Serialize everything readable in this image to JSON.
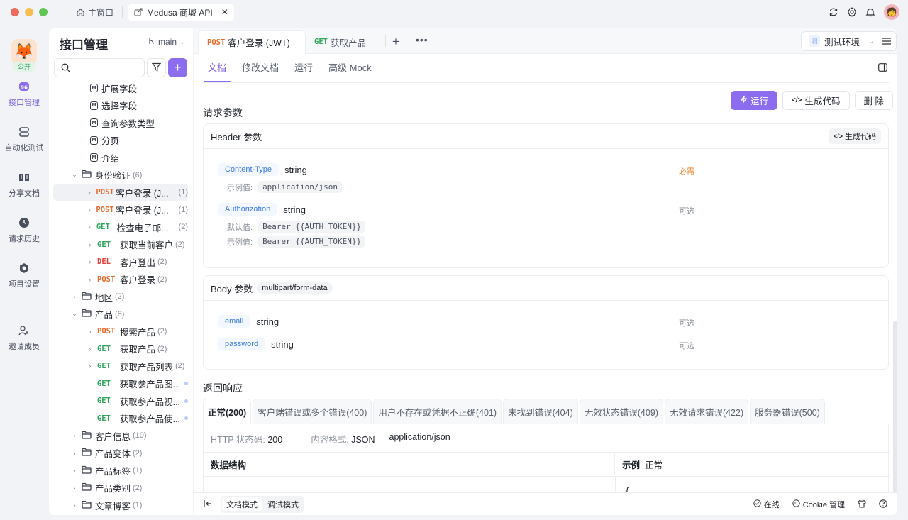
{
  "titlebar": {
    "home_label": "主窗口",
    "window_tab": "Medusa 商城 API"
  },
  "rail": {
    "public_badge": "公开",
    "items": [
      {
        "label": "接口管理",
        "icon": "api-icon",
        "active": true
      },
      {
        "label": "自动化测试",
        "icon": "automation-icon"
      },
      {
        "label": "分享文档",
        "icon": "book-icon"
      },
      {
        "label": "请求历史",
        "icon": "clock-icon"
      },
      {
        "label": "项目设置",
        "icon": "settings-hex-icon"
      },
      {
        "label": "邀请成员",
        "icon": "user-plus-icon"
      }
    ]
  },
  "sidebar": {
    "title": "接口管理",
    "branch": "main",
    "search_placeholder": "",
    "tree": [
      {
        "type": "doc",
        "label": "扩展字段",
        "indent": 2
      },
      {
        "type": "doc",
        "label": "选择字段",
        "indent": 2
      },
      {
        "type": "doc",
        "label": "查询参数类型",
        "indent": 2
      },
      {
        "type": "doc",
        "label": "分页",
        "indent": 2
      },
      {
        "type": "doc",
        "label": "介绍",
        "indent": 2
      },
      {
        "type": "folder",
        "label": "身份验证",
        "count": "(6)",
        "expanded": true,
        "indent": 1
      },
      {
        "type": "api",
        "method": "POST",
        "label": "客户登录 (J...",
        "count": "(1)",
        "indent": 2,
        "selected": true,
        "chev": true
      },
      {
        "type": "api",
        "method": "POST",
        "label": "客户登录 (J...",
        "count": "(1)",
        "indent": 2,
        "chev": true
      },
      {
        "type": "api",
        "method": "GET",
        "label": "检查电子邮...",
        "count": "(2)",
        "indent": 2,
        "chev": true
      },
      {
        "type": "api",
        "method": "GET",
        "label": "获取当前客户",
        "count": "(2)",
        "indent": 2,
        "chev": true
      },
      {
        "type": "api",
        "method": "DEL",
        "label": "客户登出",
        "count": "(2)",
        "indent": 2,
        "chev": true
      },
      {
        "type": "api",
        "method": "POST",
        "label": "客户登录",
        "count": "(2)",
        "indent": 2,
        "chev": true
      },
      {
        "type": "folder",
        "label": "地区",
        "count": "(2)",
        "expanded": false,
        "indent": 1
      },
      {
        "type": "folder",
        "label": "产品",
        "count": "(6)",
        "expanded": true,
        "indent": 1
      },
      {
        "type": "api",
        "method": "POST",
        "label": "搜索产品",
        "count": "(2)",
        "indent": 2,
        "chev": true
      },
      {
        "type": "api",
        "method": "GET",
        "label": "获取产品",
        "count": "(2)",
        "indent": 2,
        "chev": true
      },
      {
        "type": "api",
        "method": "GET",
        "label": "获取产品列表",
        "count": "(2)",
        "indent": 2,
        "chev": true
      },
      {
        "type": "api",
        "method": "GET",
        "label": "获取参产品图...",
        "indent": 2,
        "dot": true
      },
      {
        "type": "api",
        "method": "GET",
        "label": "获取参产品视...",
        "indent": 2,
        "dot": true
      },
      {
        "type": "api",
        "method": "GET",
        "label": "获取参产品使...",
        "indent": 2,
        "dot": true
      },
      {
        "type": "folder",
        "label": "客户信息",
        "count": "(10)",
        "expanded": false,
        "indent": 1
      },
      {
        "type": "folder",
        "label": "产品变体",
        "count": "(2)",
        "expanded": false,
        "indent": 1
      },
      {
        "type": "folder",
        "label": "产品标签",
        "count": "(1)",
        "expanded": false,
        "indent": 1
      },
      {
        "type": "folder",
        "label": "产品类别",
        "count": "(2)",
        "expanded": false,
        "indent": 1
      },
      {
        "type": "folder",
        "label": "文章博客",
        "count": "(1)",
        "expanded": false,
        "indent": 1
      }
    ]
  },
  "main": {
    "doc_tabs": [
      {
        "method": "POST",
        "label": "客户登录 (JWT)",
        "active": true
      },
      {
        "method": "GET",
        "label": "获取产品"
      }
    ],
    "environment": {
      "badge": "测",
      "label": "测试环境"
    },
    "sub_tabs": [
      "文档",
      "修改文档",
      "运行",
      "高级 Mock"
    ],
    "actions": {
      "run": "运行",
      "gen_code": "生成代码",
      "delete": "删 除"
    },
    "request_params_title": "请求参数",
    "header_params": {
      "title": "Header 参数",
      "gen_code": "生成代码",
      "items": [
        {
          "name": "Content-Type",
          "type": "string",
          "required": "必需",
          "example_label": "示例值:",
          "example": "application/json"
        },
        {
          "name": "Authorization",
          "type": "string",
          "required": "可选",
          "default_label": "默认值:",
          "default": "Bearer {{AUTH_TOKEN}}",
          "example_label": "示例值:",
          "example": "Bearer {{AUTH_TOKEN}}"
        }
      ]
    },
    "body_params": {
      "title": "Body 参数",
      "content_type": "multipart/form-data",
      "items": [
        {
          "name": "email",
          "type": "string",
          "required": "可选"
        },
        {
          "name": "password",
          "type": "string",
          "required": "可选"
        }
      ]
    },
    "response": {
      "title": "返回响应",
      "tabs": [
        "正常(200)",
        "客户端错误或多个错误(400)",
        "用户不存在或凭据不正确(401)",
        "未找到错误(404)",
        "无效状态错误(409)",
        "无效请求错误(422)",
        "服务器错误(500)"
      ],
      "status_label": "HTTP 状态码:",
      "status_value": "200",
      "format_label": "内容格式:",
      "format_value": "JSON",
      "mime": "application/json",
      "struct_label": "数据结构",
      "example_label": "示例",
      "example_name": "正常",
      "example_code": "{"
    },
    "footer": {
      "modes": [
        "文档模式",
        "调试模式"
      ],
      "online": "在线",
      "cookie": "Cookie 管理"
    }
  },
  "colors": {
    "accent": "#8c6cef",
    "post": "#e8692c",
    "get": "#2ea55c",
    "del": "#e5413c",
    "required": "#f0883a",
    "param_name": "#3e7be0"
  }
}
